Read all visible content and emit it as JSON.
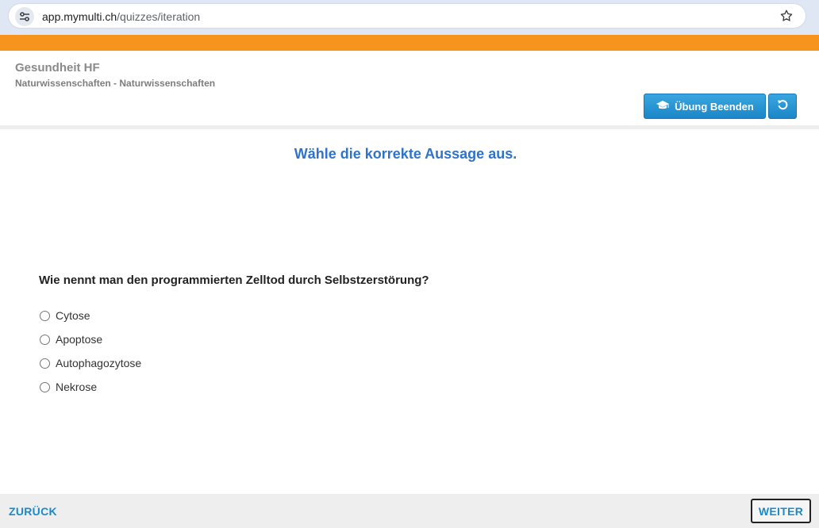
{
  "browser": {
    "url_host": "app.mymulti.ch",
    "url_path": "/quizzes/iteration",
    "site_icon": "tune-icon",
    "bookmark_icon": "star-icon"
  },
  "colors": {
    "accent_orange": "#f7941d",
    "button_blue": "#1c86c7",
    "instruction_blue": "#2f74c8",
    "link_blue": "#1a8ac9"
  },
  "header": {
    "title": "Gesundheit HF",
    "subtitle": "Naturwissenschaften - Naturwissenschaften",
    "end_button_label": "Übung Beenden",
    "end_button_icon": "graduation-cap-icon",
    "reset_button_icon": "undo-icon"
  },
  "main": {
    "instruction": "Wähle die korrekte Aussage aus.",
    "question": "Wie nennt man den programmierten Zelltod durch Selbstzerstörung?",
    "options": [
      "Cytose",
      "Apoptose",
      "Autophagozytose",
      "Nekrose"
    ]
  },
  "footer": {
    "back_label": "ZURÜCK",
    "next_label": "WEITER"
  }
}
